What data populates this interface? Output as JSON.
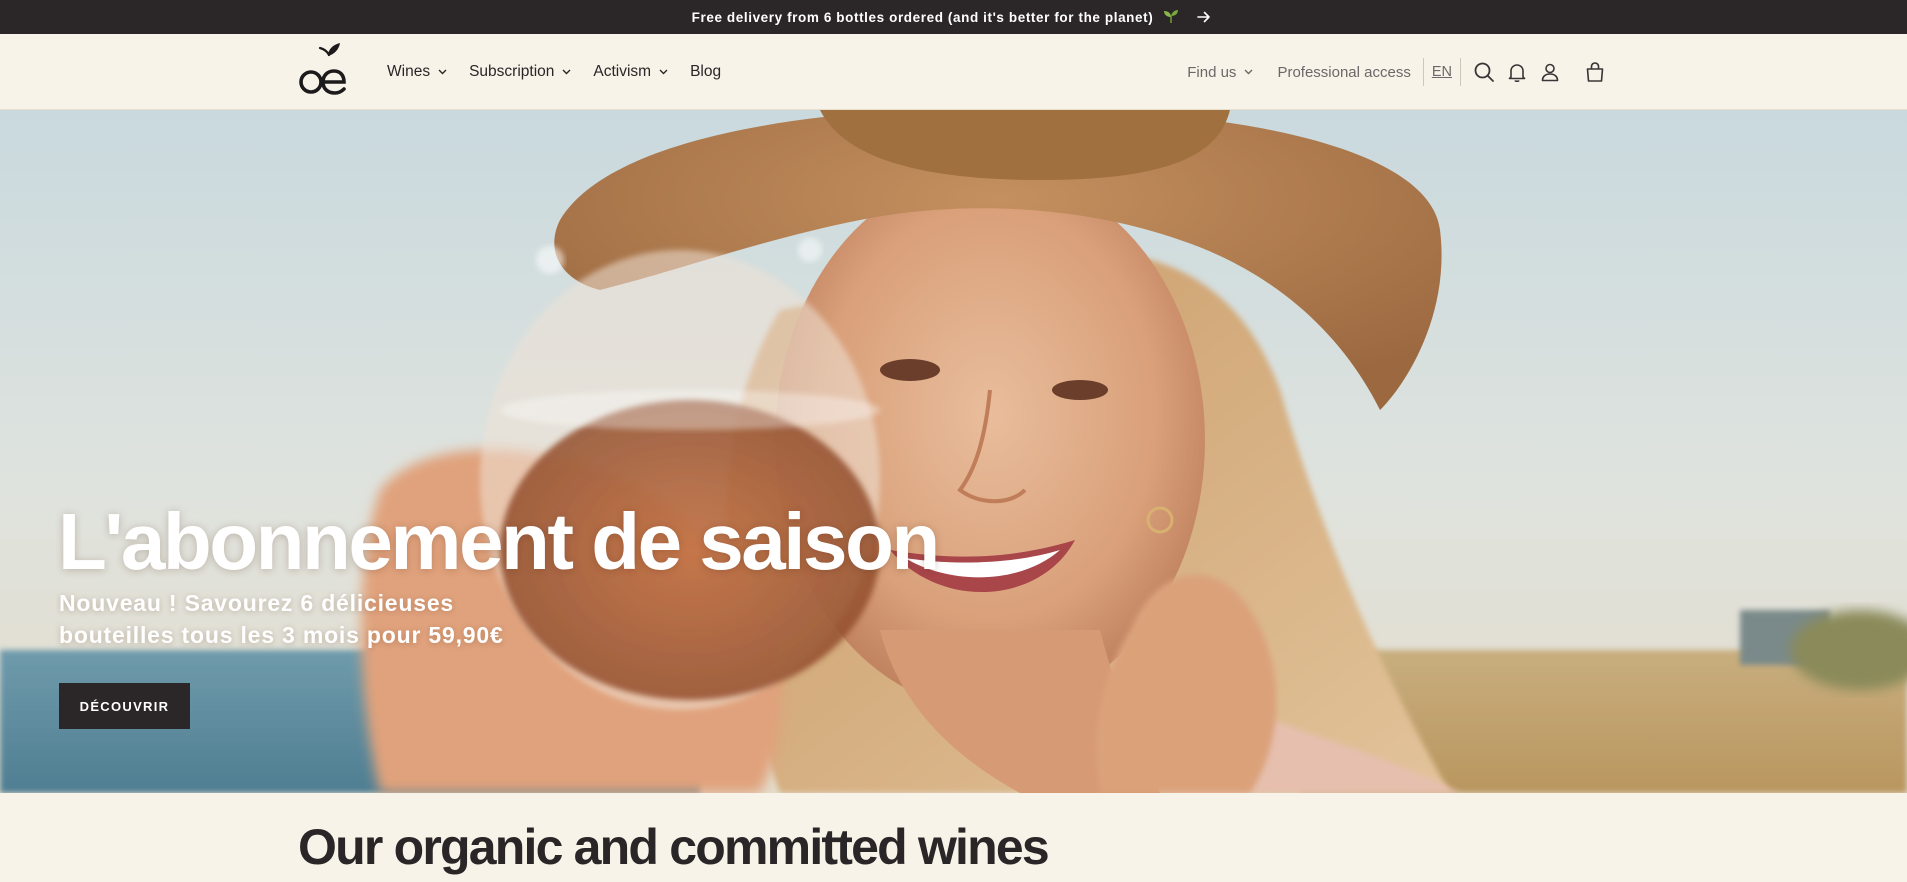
{
  "announcement": {
    "text": "Free delivery from 6 bottles ordered (and it's better for the planet)",
    "emoji_icon": "sprout-icon",
    "arrow_icon": "arrow-right-icon"
  },
  "header": {
    "logo_text": "oé",
    "nav": [
      {
        "label": "Wines",
        "has_dropdown": true
      },
      {
        "label": "Subscription",
        "has_dropdown": true
      },
      {
        "label": "Activism",
        "has_dropdown": true
      },
      {
        "label": "Blog",
        "has_dropdown": false
      }
    ],
    "utility": {
      "find_us": "Find us",
      "professional": "Professional access",
      "language": "EN",
      "icons": [
        "search-icon",
        "bell-icon",
        "account-icon",
        "cart-icon"
      ]
    }
  },
  "hero": {
    "title": "L'abonnement de saison",
    "subtitle_line1": "Nouveau ! Savourez 6 délicieuses",
    "subtitle_line2": "bouteilles tous les 3 mois pour 59,90€",
    "cta": "DÉCOUVRIR"
  },
  "section": {
    "title": "Our organic and committed wines"
  },
  "colors": {
    "dark": "#2b2728",
    "cream": "#f8f3e8",
    "sprout": "#8ab64a"
  }
}
